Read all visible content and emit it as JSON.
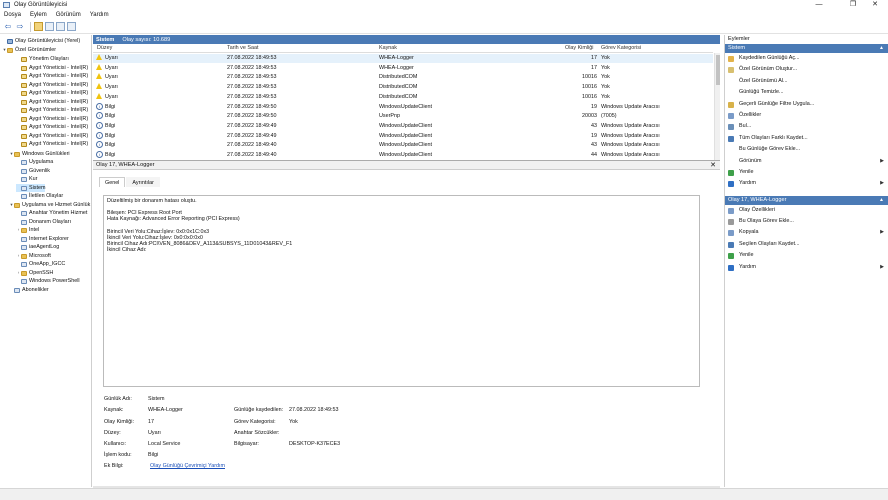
{
  "window": {
    "title": "Olay Görüntüleyicisi",
    "minimize": "—",
    "maximize": "❐",
    "close": "✕"
  },
  "menu": [
    "Dosya",
    "Eylem",
    "Görünüm",
    "Yardım"
  ],
  "toolbar": {
    "back": "⇦",
    "forward": "⇨"
  },
  "tree": [
    {
      "label": "Olay Görüntüleyicisi (Yerel)",
      "level": 0,
      "exp": "",
      "icon": "pc"
    },
    {
      "label": "Özel Görünümler",
      "level": 0,
      "exp": "▾",
      "icon": "folder"
    },
    {
      "label": "Yönetim Olayları",
      "level": 2,
      "exp": "",
      "icon": "filter"
    },
    {
      "label": "Aygıt Yöneticisi - Intel(R)",
      "level": 2,
      "exp": "",
      "icon": "filter"
    },
    {
      "label": "Aygıt Yöneticisi - Intel(R)",
      "level": 2,
      "exp": "",
      "icon": "filter"
    },
    {
      "label": "Aygıt Yöneticisi - Intel(R)",
      "level": 2,
      "exp": "",
      "icon": "filter"
    },
    {
      "label": "Aygıt Yöneticisi - Intel(R)",
      "level": 2,
      "exp": "",
      "icon": "filter"
    },
    {
      "label": "Aygıt Yöneticisi - Intel(R)",
      "level": 2,
      "exp": "",
      "icon": "filter"
    },
    {
      "label": "Aygıt Yöneticisi - Intel(R)",
      "level": 2,
      "exp": "",
      "icon": "filter"
    },
    {
      "label": "Aygıt Yöneticisi - Intel(R)",
      "level": 2,
      "exp": "",
      "icon": "filter"
    },
    {
      "label": "Aygıt Yöneticisi - Intel(R)",
      "level": 2,
      "exp": "",
      "icon": "filter"
    },
    {
      "label": "Aygıt Yöneticisi - Intel(R)",
      "level": 2,
      "exp": "",
      "icon": "filter"
    },
    {
      "label": "Aygıt Yöneticisi - Intel(R)",
      "level": 2,
      "exp": "",
      "icon": "filter"
    },
    {
      "label": "Windows Günlükleri",
      "level": 1,
      "exp": "▾",
      "icon": "folder"
    },
    {
      "label": "Uygulama",
      "level": 2,
      "exp": "",
      "icon": "log"
    },
    {
      "label": "Güvenlik",
      "level": 2,
      "exp": "",
      "icon": "log"
    },
    {
      "label": "Kur",
      "level": 2,
      "exp": "",
      "icon": "log"
    },
    {
      "label": "Sistem",
      "level": 2,
      "exp": "",
      "icon": "log",
      "selected": true
    },
    {
      "label": "İletilen Olaylar",
      "level": 2,
      "exp": "",
      "icon": "log"
    },
    {
      "label": "Uygulama ve Hizmet Günlük",
      "level": 1,
      "exp": "▾",
      "icon": "folder"
    },
    {
      "label": "Anahtar Yönetim Hizmet",
      "level": 2,
      "exp": "",
      "icon": "log"
    },
    {
      "label": "Donanım Olayları",
      "level": 2,
      "exp": "",
      "icon": "log"
    },
    {
      "label": "Intel",
      "level": 2,
      "exp": "›",
      "icon": "folder"
    },
    {
      "label": "Internet Explorer",
      "level": 2,
      "exp": "",
      "icon": "log"
    },
    {
      "label": "iaeAgentLog",
      "level": 2,
      "exp": "",
      "icon": "log"
    },
    {
      "label": "Microsoft",
      "level": 2,
      "exp": "›",
      "icon": "folder"
    },
    {
      "label": "OneApp_IGCC",
      "level": 2,
      "exp": "",
      "icon": "log"
    },
    {
      "label": "OpenSSH",
      "level": 2,
      "exp": "›",
      "icon": "folder"
    },
    {
      "label": "Windows PowerShell",
      "level": 2,
      "exp": "",
      "icon": "log"
    },
    {
      "label": "Abonelikler",
      "level": 1,
      "exp": "",
      "icon": "log"
    }
  ],
  "grid": {
    "log_name": "Sistem",
    "count": "Olay sayısı: 10.689",
    "columns": [
      "Düzey",
      "Tarih ve Saat",
      "Kaynak",
      "Olay Kimliği",
      "Görev Kategorisi"
    ],
    "rows": [
      {
        "level": "Uyarı",
        "type": "warn",
        "date": "27.08.2022 18:49:53",
        "source": "WHEA-Logger",
        "id": "17",
        "cat": "Yok",
        "selected": true
      },
      {
        "level": "Uyarı",
        "type": "warn",
        "date": "27.08.2022 18:49:53",
        "source": "WHEA-Logger",
        "id": "17",
        "cat": "Yok"
      },
      {
        "level": "Uyarı",
        "type": "warn",
        "date": "27.08.2022 18:49:53",
        "source": "DistributedCOM",
        "id": "10016",
        "cat": "Yok"
      },
      {
        "level": "Uyarı",
        "type": "warn",
        "date": "27.08.2022 18:49:53",
        "source": "DistributedCOM",
        "id": "10016",
        "cat": "Yok"
      },
      {
        "level": "Uyarı",
        "type": "warn",
        "date": "27.08.2022 18:49:53",
        "source": "DistributedCOM",
        "id": "10016",
        "cat": "Yok"
      },
      {
        "level": "Bilgi",
        "type": "info",
        "date": "27.08.2022 18:49:50",
        "source": "WindowsUpdateClient",
        "id": "19",
        "cat": "Windows Update Aracısı"
      },
      {
        "level": "Bilgi",
        "type": "info",
        "date": "27.08.2022 18:49:50",
        "source": "UserPnp",
        "id": "20003",
        "cat": "(7005)"
      },
      {
        "level": "Bilgi",
        "type": "info",
        "date": "27.08.2022 18:49:49",
        "source": "WindowsUpdateClient",
        "id": "43",
        "cat": "Windows Update Aracısı"
      },
      {
        "level": "Bilgi",
        "type": "info",
        "date": "27.08.2022 18:49:49",
        "source": "WindowsUpdateClient",
        "id": "19",
        "cat": "Windows Update Aracısı"
      },
      {
        "level": "Bilgi",
        "type": "info",
        "date": "27.08.2022 18:49:40",
        "source": "WindowsUpdateClient",
        "id": "43",
        "cat": "Windows Update Aracısı"
      },
      {
        "level": "Bilgi",
        "type": "info",
        "date": "27.08.2022 18:49:40",
        "source": "WindowsUpdateClient",
        "id": "44",
        "cat": "Windows Update Aracısı"
      }
    ]
  },
  "detail": {
    "header": "Olay 17, WHEA-Logger",
    "close": "✕",
    "tabs": [
      "Genel",
      "Ayrıntılar"
    ],
    "message": [
      "Düzeltilmiş bir donanım hatası oluştu.",
      "",
      "Bileşen: PCI Express Root Port",
      "Hata Kaynağı: Advanced Error Reporting (PCI Express)",
      "",
      "Birincil Veri Yolu:Cihaz:İşlev: 0x0:0x1C:0x3",
      "İkincil Veri Yolu:Cihaz:İşlev: 0x0:0x0:0x0",
      "Birincil Cihaz Adı:PCI\\VEN_8086&DEV_A113&SUBSYS_11D01043&REV_F1",
      "İkincil Cihaz Adı:"
    ],
    "props": {
      "log_name_label": "Günlük Adı:",
      "log_name": "Sistem",
      "source_label": "Kaynak:",
      "source": "WHEA-Logger",
      "logged_label": "Günlüğe kaydedilen:",
      "logged": "27.08.2022 18:49:53",
      "event_id_label": "Olay Kimliği:",
      "event_id": "17",
      "task_label": "Görev Kategorisi:",
      "task": "Yok",
      "level_label": "Düzey:",
      "level": "Uyarı",
      "keywords_label": "Anahtar Sözcükler:",
      "keywords": "",
      "user_label": "Kullanıcı:",
      "user": "Local Service",
      "computer_label": "Bilgisayar:",
      "computer": "DESKTOP-K37ECE3",
      "opcode_label": "İşlem kodu:",
      "opcode": "Bilgi",
      "more_label": "Ek Bilgi:",
      "more_link": "Olay Günlüğü Çevrimiçi Yardım"
    }
  },
  "actions": {
    "title": "Eylemler",
    "section1": "Sistem",
    "items1": [
      {
        "label": "Kaydedilen Günlüğü Aç...",
        "icon": "#e3b34a"
      },
      {
        "label": "Özel Görünüm Oluştur...",
        "icon": "#d8c070"
      },
      {
        "label": "Özel Görünümü Al...",
        "icon": ""
      },
      {
        "label": "Günlüğü Temizle...",
        "icon": ""
      },
      {
        "label": "Geçerli Günlüğe Filtre Uygula...",
        "icon": "#d8b24a"
      },
      {
        "label": "Özellikler",
        "icon": "#7a9bc8"
      },
      {
        "label": "Bul...",
        "icon": "#6a8fb8"
      },
      {
        "label": "Tüm Olayları Farklı Kaydet...",
        "icon": "#4a7ab5"
      },
      {
        "label": "Bu Günlüğe Görev Ekle...",
        "icon": ""
      },
      {
        "label": "Görünüm",
        "icon": "",
        "sub": true
      },
      {
        "label": "Yenile",
        "icon": "#3ea04a"
      },
      {
        "label": "Yardım",
        "icon": "#2f6fc4",
        "sub": true
      }
    ],
    "section2": "Olay 17, WHEA-Logger",
    "items2": [
      {
        "label": "Olay Özellikleri",
        "icon": "#7a9bc8"
      },
      {
        "label": "Bu Olaya Görev Ekle...",
        "icon": "#9a9a9a"
      },
      {
        "label": "Kopyala",
        "icon": "#7a9bc8",
        "sub": true
      },
      {
        "label": "Seçilen Olayları Kaydet...",
        "icon": "#4a7ab5"
      },
      {
        "label": "Yenile",
        "icon": "#3ea04a"
      },
      {
        "label": "Yardım",
        "icon": "#2f6fc4",
        "sub": true
      }
    ]
  }
}
